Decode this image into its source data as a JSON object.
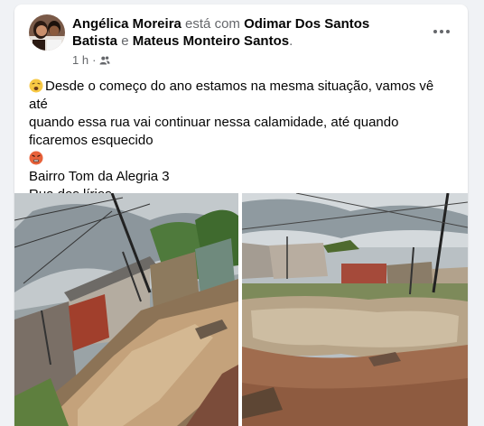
{
  "post": {
    "author": "Angélica Moreira",
    "with_text": "está com",
    "tagged_1": "Odimar Dos Santos Batista",
    "and_text": "e",
    "tagged_2": "Mateus Monteiro Santos",
    "tagged_end": ".",
    "time": "1 h",
    "meta_sep": "·",
    "lines": [
      "Desde o começo do ano estamos na mesma situação, vamos vê até",
      "quando essa rua vai continuar nessa calamidade, até quando",
      "ficaremos esquecido",
      "Bairro Tom da Alegria 3",
      "Rua dos lírios"
    ]
  },
  "icons": {
    "privacy": "friends-icon",
    "emoji_1": "weary-face-icon",
    "emoji_2": "angry-face-icon",
    "menu": "more-options-icon"
  },
  "colors": {
    "card": "#ffffff",
    "page_bg": "#f0f2f5",
    "text": "#050505",
    "secondary": "#65676b"
  }
}
